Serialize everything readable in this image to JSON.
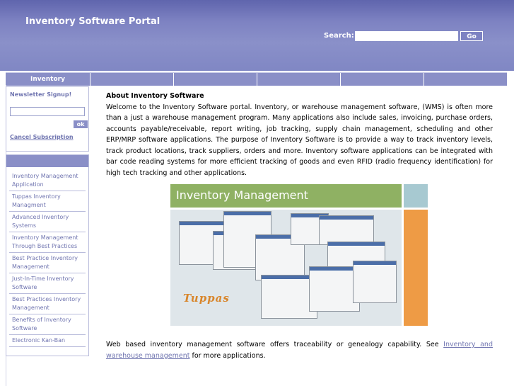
{
  "header": {
    "title": "Inventory Software Portal",
    "search_label": "Search:",
    "search_value": "",
    "go_label": "Go"
  },
  "nav": {
    "tabs": [
      "Inventory",
      "",
      "",
      "",
      "",
      ""
    ]
  },
  "newsletter": {
    "title": "Newsletter Signup!",
    "input_value": "",
    "ok_label": "ok",
    "cancel_label": "Cancel Subscription"
  },
  "sidebar_links": [
    "Inventory Management Application",
    "Tuppas Inventory Managment",
    "Advanced Inventory Systems",
    "Inventory Management Through Best Practices",
    "Best Practice Inventory Management",
    "Just-In-Time Inventory Software",
    "Best Practices Inventory Management",
    "Benefits of Inventory Software",
    "Electronic Kan-Ban"
  ],
  "main": {
    "title": "About Inventory Software",
    "body": "Welcome to the Inventory Software portal. Inventory, or warehouse management software, (WMS) is often more than a just a warehouse management program. Many applications also include sales, invoicing, purchase orders, accounts payable/receivable, report writing, job tracking, supply chain management, scheduling and other ERP/MRP software applications. The purpose of Inventory Software is to provide a way to track inventory levels, track product locations, track suppliers, orders and more. Inventory software applications can be integrated with bar code reading systems for more efficient tracking of goods and even RFID (radio frequency identification) for high tech tracking and other applications.",
    "banner_title": "Inventory Management",
    "banner_logo": "Tuppas",
    "footer_before": "Web based inventory management software offers traceability or genealogy capability. See ",
    "footer_link": "Inventory and warehouse management",
    "footer_after": " for more applications."
  },
  "colors": {
    "header": "#7d82c2",
    "nav": "#8a8fc7",
    "link": "#7075b0",
    "banner_green": "#8fb163",
    "banner_orange": "#ee9b45",
    "banner_blue": "#a7c9d1"
  }
}
